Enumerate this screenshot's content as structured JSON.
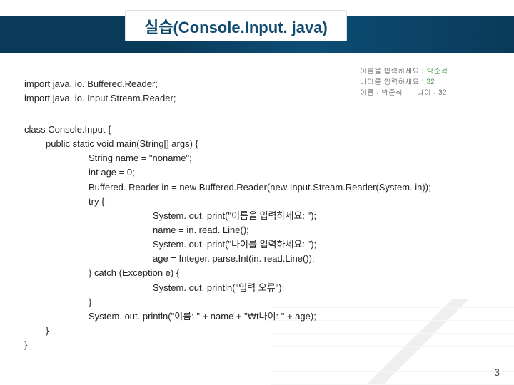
{
  "title": "실습(Console.Input. java)",
  "console": {
    "line1_label": "이름을 입력하세요 : ",
    "line1_value": "박준석",
    "line2_label": "나이를 입력하세요 : ",
    "line2_value": "32",
    "line3_a": "이름 : 박준석",
    "line3_b": "나이 : 32"
  },
  "imports": {
    "l1": "import java. io. Buffered.Reader;",
    "l2": "import java. io. Input.Stream.Reader;"
  },
  "code": {
    "c01": "class Console.Input {",
    "c02": "public static void main(String[] args) {",
    "c03": "String name = \"noname\";",
    "c04": "int age = 0;",
    "c05": "Buffered. Reader in = new Buffered.Reader(new Input.Stream.Reader(System. in));",
    "c06": "try {",
    "c07": "System. out. print(\"이름을 입력하세요: \");",
    "c08": "name = in. read. Line();",
    "c09": "System. out. print(\"나이를 입력하세요: \");",
    "c10": "age = Integer. parse.Int(in. read.Line());",
    "c11": "} catch (Exception e) {",
    "c12": "System. out. println(\"입력 오류\");",
    "c13": "}",
    "c14": "System. out. println(\"이름: \" + name + \"₩t나이: \" + age);",
    "c15": "}",
    "c16": "}"
  },
  "page": "3"
}
